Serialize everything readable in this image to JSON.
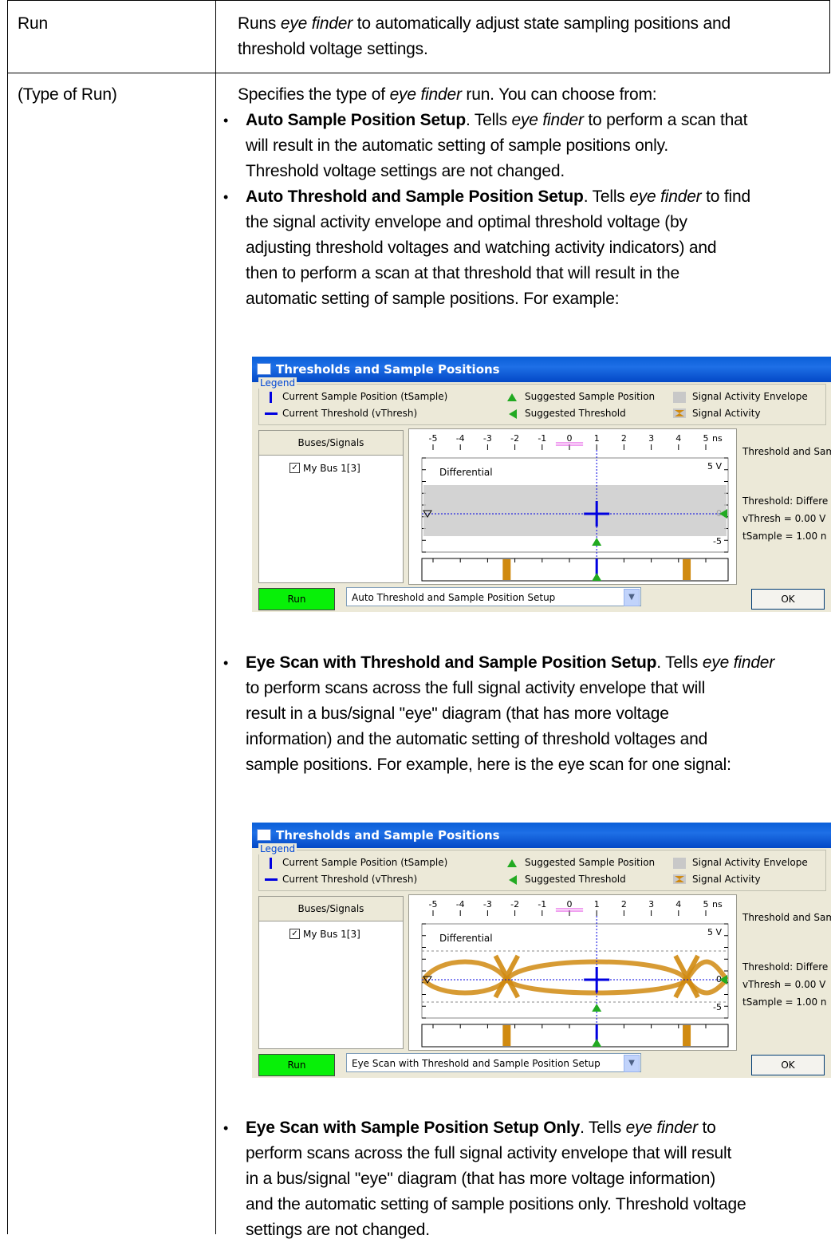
{
  "rows": [
    {
      "label": "Run",
      "desc_pre": "Runs ",
      "desc_italic": "eye finder",
      "desc_post_1": " to automatically adjust state sampling positions and",
      "desc_post_2": "threshold voltage settings."
    },
    {
      "label": "(Type of Run)",
      "intro_pre": "Specifies the type of ",
      "intro_italic": "eye finder",
      "intro_post": " run. You can choose from:"
    }
  ],
  "bullets": [
    {
      "title": "Auto Sample Position Setup",
      "lines": [
        [
          ". Tells ",
          "eye finder",
          " to perform a scan that"
        ],
        [
          "will result in the automatic setting of sample positions only."
        ],
        [
          "Threshold voltage settings are not changed."
        ]
      ]
    },
    {
      "title": "Auto Threshold and Sample Position Setup",
      "lines": [
        [
          ". Tells ",
          "eye finder",
          " to find"
        ],
        [
          "the signal activity envelope and optimal threshold voltage (by"
        ],
        [
          "adjusting threshold voltages and watching activity indicators) and"
        ],
        [
          "then to perform a scan at that threshold that will result in the"
        ],
        [
          "automatic setting of sample positions. For example:"
        ]
      ]
    },
    {
      "title": "Eye Scan with Threshold and Sample Position Setup",
      "lines": [
        [
          ". Tells ",
          "eye finder",
          ""
        ],
        [
          "to perform scans across the full signal activity envelope that will"
        ],
        [
          "result in a bus/signal \"eye\" diagram (that has more voltage"
        ],
        [
          "information) and the automatic setting of threshold voltages and"
        ],
        [
          "sample positions. For example, here is the eye scan for one signal:"
        ]
      ]
    },
    {
      "title": "Eye Scan with Sample Position Setup Only",
      "lines": [
        [
          ". Tells ",
          "eye finder",
          " to"
        ],
        [
          "perform scans across the full signal activity envelope that will result"
        ],
        [
          "in a bus/signal \"eye\" diagram (that has more voltage information)"
        ],
        [
          "and the automatic setting of sample positions only. Threshold voltage"
        ],
        [
          "settings are not changed."
        ]
      ]
    }
  ],
  "dialogs": [
    {
      "title": "Thresholds and Sample Positions",
      "legend_caption": "Legend",
      "legend_items": [
        "Current Sample Position (tSample)",
        "Current Threshold (vThresh)",
        "Suggested Sample Position",
        "Suggested Threshold",
        "Signal Activity Envelope",
        "Signal Activity"
      ],
      "bus_header": "Buses/Signals",
      "bus_item": "My Bus 1[3]",
      "check_mark": "✓",
      "axis_ticks": [
        "-5",
        "-4",
        "-3",
        "-2",
        "-1",
        "0",
        "1",
        "2",
        "3",
        "4",
        "5"
      ],
      "axis_unit": "ns",
      "signal_label": "Differential",
      "v_top": "5 V",
      "v_mid": "0",
      "v_bot": "-5",
      "info_title": "Threshold and Sam",
      "info_threshold": "Threshold: Differe",
      "info_vthresh": "vThresh = 0.00 V",
      "info_tsample": "tSample = 1.00 n",
      "run_label": "Run",
      "combo_value": "Auto Threshold and Sample Position Setup",
      "ok_label": "OK",
      "eye": false
    },
    {
      "title": "Thresholds and Sample Positions",
      "legend_caption": "Legend",
      "legend_items": [
        "Current Sample Position (tSample)",
        "Current Threshold (vThresh)",
        "Suggested Sample Position",
        "Suggested Threshold",
        "Signal Activity Envelope",
        "Signal Activity"
      ],
      "bus_header": "Buses/Signals",
      "bus_item": "My Bus 1[3]",
      "check_mark": "✓",
      "axis_ticks": [
        "-5",
        "-4",
        "-3",
        "-2",
        "-1",
        "0",
        "1",
        "2",
        "3",
        "4",
        "5"
      ],
      "axis_unit": "ns",
      "signal_label": "Differential",
      "v_top": "5 V",
      "v_mid": "0",
      "v_bot": "-5",
      "info_title": "Threshold and Sam",
      "info_threshold": "Threshold: Differe",
      "info_vthresh": "vThresh = 0.00 V",
      "info_tsample": "tSample = 1.00 n",
      "run_label": "Run",
      "combo_value": "Eye Scan with Threshold and Sample Position Setup",
      "ok_label": "OK",
      "eye": true
    }
  ],
  "colors": {
    "title_bar": "#0a5fd8",
    "run_button": "#08f008",
    "marker_blue": "#0000e0",
    "marker_green": "#22aa22",
    "activity": "#d08a10",
    "envelope": "#c8c8c8"
  }
}
